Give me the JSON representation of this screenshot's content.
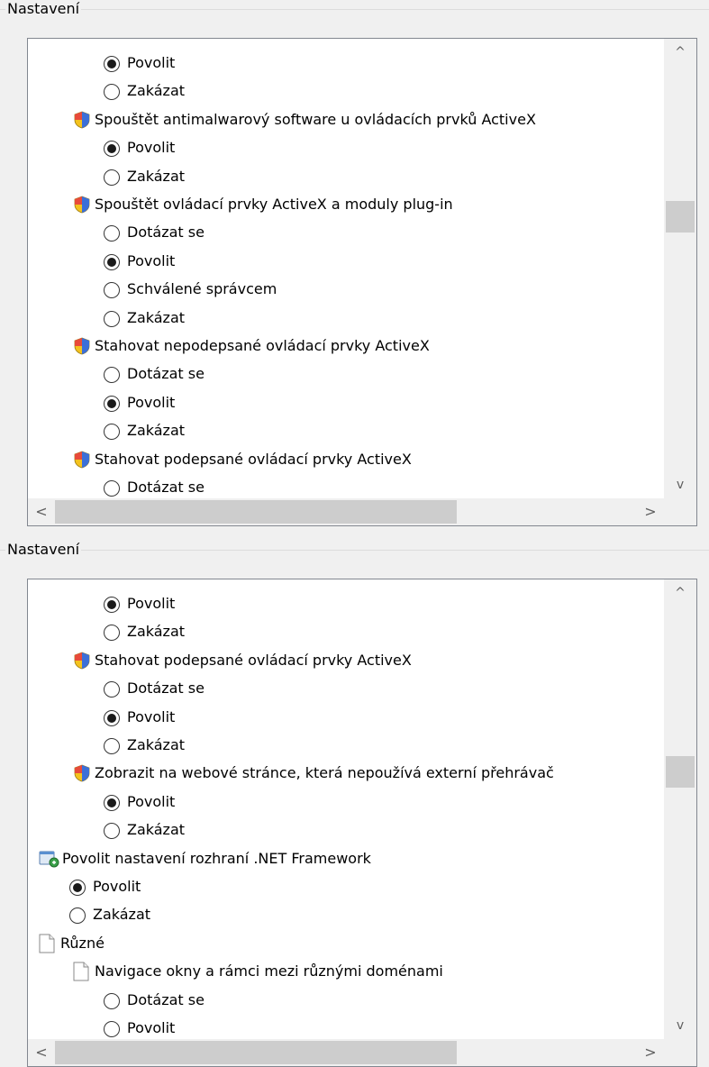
{
  "groups": [
    {
      "title": "Nastavení",
      "rows": [
        {
          "type": "radio",
          "indent": 2,
          "checked": true,
          "label": "Povolit"
        },
        {
          "type": "radio",
          "indent": 2,
          "checked": false,
          "label": "Zakázat"
        },
        {
          "type": "heading",
          "icon": "shield-icon",
          "indent": 1,
          "label": "Spouštět antimalwarový software u ovládacích prvků ActiveX"
        },
        {
          "type": "radio",
          "indent": 2,
          "checked": true,
          "label": "Povolit"
        },
        {
          "type": "radio",
          "indent": 2,
          "checked": false,
          "label": "Zakázat"
        },
        {
          "type": "heading",
          "icon": "shield-icon",
          "indent": 1,
          "label": "Spouštět ovládací prvky ActiveX a moduly plug-in"
        },
        {
          "type": "radio",
          "indent": 2,
          "checked": false,
          "label": "Dotázat se"
        },
        {
          "type": "radio",
          "indent": 2,
          "checked": true,
          "label": "Povolit"
        },
        {
          "type": "radio",
          "indent": 2,
          "checked": false,
          "label": "Schválené správcem"
        },
        {
          "type": "radio",
          "indent": 2,
          "checked": false,
          "label": "Zakázat"
        },
        {
          "type": "heading",
          "icon": "shield-icon",
          "indent": 1,
          "label": "Stahovat nepodepsané ovládací prvky ActiveX"
        },
        {
          "type": "radio",
          "indent": 2,
          "checked": false,
          "label": "Dotázat se"
        },
        {
          "type": "radio",
          "indent": 2,
          "checked": true,
          "label": "Povolit"
        },
        {
          "type": "radio",
          "indent": 2,
          "checked": false,
          "label": "Zakázat"
        },
        {
          "type": "heading",
          "icon": "shield-icon",
          "indent": 1,
          "label": "Stahovat podepsané ovládací prvky ActiveX"
        },
        {
          "type": "radio",
          "indent": 2,
          "checked": false,
          "label": "Dotázat se"
        }
      ]
    },
    {
      "title": "Nastavení",
      "rows": [
        {
          "type": "radio",
          "indent": 2,
          "checked": true,
          "label": "Povolit"
        },
        {
          "type": "radio",
          "indent": 2,
          "checked": false,
          "label": "Zakázat"
        },
        {
          "type": "heading",
          "icon": "shield-icon",
          "indent": 1,
          "label": "Stahovat podepsané ovládací prvky ActiveX"
        },
        {
          "type": "radio",
          "indent": 2,
          "checked": false,
          "label": "Dotázat se"
        },
        {
          "type": "radio",
          "indent": 2,
          "checked": true,
          "label": "Povolit"
        },
        {
          "type": "radio",
          "indent": 2,
          "checked": false,
          "label": "Zakázat"
        },
        {
          "type": "heading",
          "icon": "shield-icon",
          "indent": 1,
          "label": "Zobrazit na webové stránce, která nepoužívá externí přehrávač"
        },
        {
          "type": "radio",
          "indent": 2,
          "checked": true,
          "label": "Povolit"
        },
        {
          "type": "radio",
          "indent": 2,
          "checked": false,
          "label": "Zakázat"
        },
        {
          "type": "heading",
          "icon": "dotnet-settings-icon",
          "indent": 0,
          "label": "Povolit nastavení rozhraní .NET Framework"
        },
        {
          "type": "radio",
          "indent": 1,
          "checked": true,
          "label": "Povolit"
        },
        {
          "type": "radio",
          "indent": 1,
          "checked": false,
          "label": "Zakázat"
        },
        {
          "type": "heading",
          "icon": "document-icon",
          "indent": 0,
          "label": "Různé"
        },
        {
          "type": "heading",
          "icon": "document-icon",
          "indent": 1,
          "label": "Navigace okny a rámci mezi různými doménami"
        },
        {
          "type": "radio",
          "indent": 2,
          "checked": false,
          "label": "Dotázat se"
        },
        {
          "type": "radio",
          "indent": 2,
          "checked": false,
          "label": "Povolit"
        }
      ]
    }
  ],
  "scroll": {
    "up_arrow": "^",
    "down_arrow": "v",
    "left_arrow": "<",
    "right_arrow": ">"
  }
}
